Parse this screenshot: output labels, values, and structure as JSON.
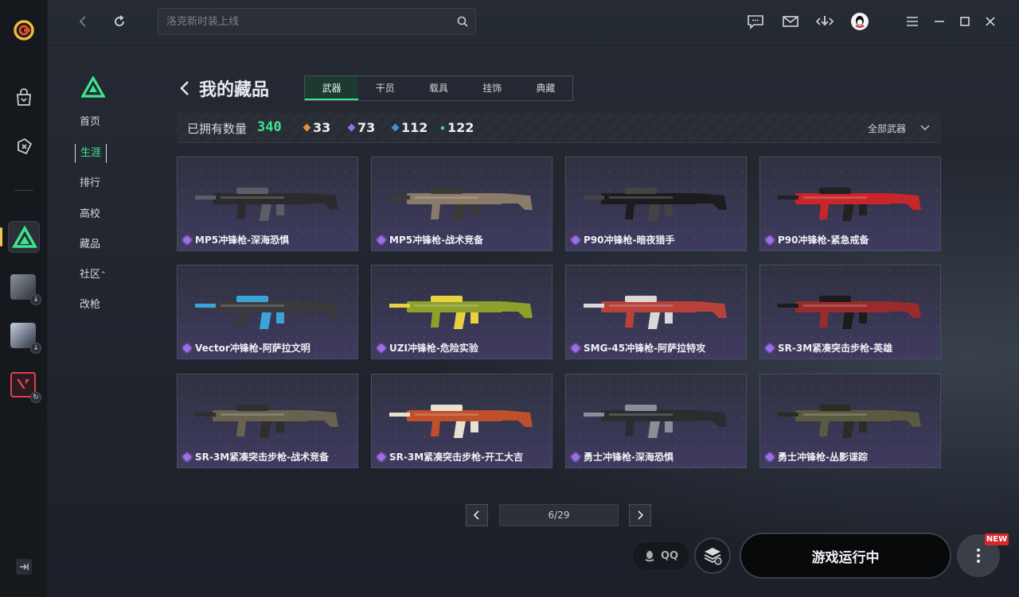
{
  "topbar": {
    "search_placeholder": "洛克新时装上线",
    "icons": [
      "back-icon",
      "refresh-icon",
      "chat-icon",
      "mail-icon",
      "download-icon",
      "avatar",
      "menu-icon",
      "minimize-icon",
      "maximize-icon",
      "close-icon"
    ]
  },
  "sidenav": {
    "items": [
      {
        "label": "首页"
      },
      {
        "label": "生涯"
      },
      {
        "label": "排行"
      },
      {
        "label": "高校"
      },
      {
        "label": "藏品"
      },
      {
        "label": "社区"
      },
      {
        "label": "改枪"
      }
    ],
    "active_index": 1
  },
  "page": {
    "title": "我的藏品",
    "tabs": [
      "武器",
      "干员",
      "载具",
      "挂饰",
      "典藏"
    ],
    "active_tab": 0
  },
  "stats": {
    "label": "已拥有数量",
    "total": "340",
    "rarities": [
      {
        "color": "#e8903a",
        "count": "33"
      },
      {
        "color": "#a06bf0",
        "count": "73"
      },
      {
        "color": "#3f8fe8",
        "count": "112"
      },
      {
        "color": "#3ee58f",
        "count": "122"
      }
    ],
    "filter_label": "全部武器"
  },
  "items": [
    {
      "name": "MP5冲锋枪-深海恐惧",
      "color": "#2b2b2e",
      "accent": "#5a5e66"
    },
    {
      "name": "MP5冲锋枪-战术竞备",
      "color": "#8a7b68",
      "accent": "#3c3a38"
    },
    {
      "name": "P90冲锋枪-暗夜猎手",
      "color": "#1c1c1e",
      "accent": "#444"
    },
    {
      "name": "P90冲锋枪-紧急戒备",
      "color": "#c8262a",
      "accent": "#222"
    },
    {
      "name": "Vector冲锋枪-阿萨拉文明",
      "color": "#3a3a3c",
      "accent": "#3aa4d8"
    },
    {
      "name": "UZI冲锋枪-危险实验",
      "color": "#8ca02a",
      "accent": "#e8d040"
    },
    {
      "name": "SMG-45冲锋枪-阿萨拉特攻",
      "color": "#b8423a",
      "accent": "#d8d8d8"
    },
    {
      "name": "SR-3M紧凑突击步枪-英雄",
      "color": "#9a2a2c",
      "accent": "#1c1c1e"
    },
    {
      "name": "SR-3M紧凑突击步枪-战术竞备",
      "color": "#6a6250",
      "accent": "#2e2e2e"
    },
    {
      "name": "SR-3M紧凑突击步枪-开工大吉",
      "color": "#c0502a",
      "accent": "#e8e0d0"
    },
    {
      "name": "勇士冲锋枪-深海恐惧",
      "color": "#2a2c30",
      "accent": "#8a8e96"
    },
    {
      "name": "勇士冲锋枪-丛影谍踪",
      "color": "#5a5a40",
      "accent": "#2c2c24"
    }
  ],
  "pager": {
    "indicator": "6/29"
  },
  "bottom": {
    "qq_label": "QQ",
    "launch_label": "游戏运行中",
    "new_badge": "NEW"
  }
}
